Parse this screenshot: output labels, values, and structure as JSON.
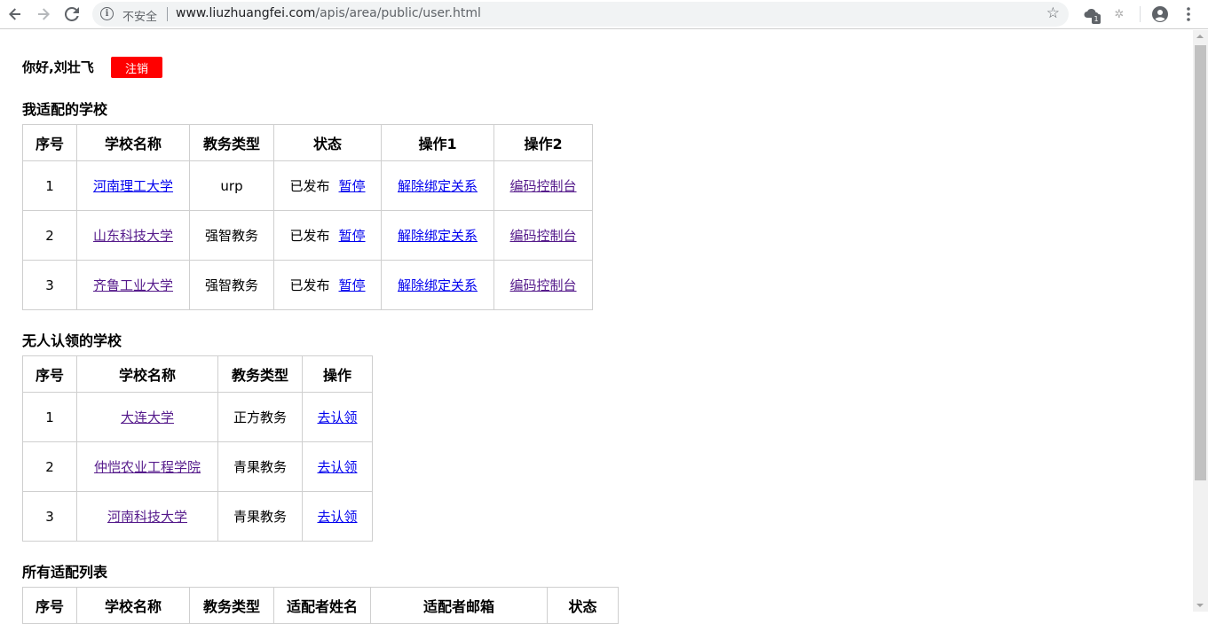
{
  "browser": {
    "insecure_label": "不安全",
    "url_host": "www.liuzhuangfei.com",
    "url_path": "/apis/area/public/user.html",
    "ext_badge": "1"
  },
  "header": {
    "greeting": "你好,刘壮飞",
    "logout_label": "注销",
    "logout_color": "#ff0000"
  },
  "my_schools": {
    "title": "我适配的学校",
    "columns": [
      "序号",
      "学校名称",
      "教务类型",
      "状态",
      "操作1",
      "操作2"
    ],
    "rows": [
      {
        "id": "1",
        "name": "河南理工大学",
        "type": "urp",
        "status": "已发布",
        "toggle": "暂停",
        "op1": "解除绑定关系",
        "op2": "编码控制台"
      },
      {
        "id": "2",
        "name": "山东科技大学",
        "type": "强智教务",
        "status": "已发布",
        "toggle": "暂停",
        "op1": "解除绑定关系",
        "op2": "编码控制台"
      },
      {
        "id": "3",
        "name": "齐鲁工业大学",
        "type": "强智教务",
        "status": "已发布",
        "toggle": "暂停",
        "op1": "解除绑定关系",
        "op2": "编码控制台"
      }
    ]
  },
  "unclaimed": {
    "title": "无人认领的学校",
    "columns": [
      "序号",
      "学校名称",
      "教务类型",
      "操作"
    ],
    "rows": [
      {
        "id": "1",
        "name": "大连大学",
        "type": "正方教务",
        "action": "去认领"
      },
      {
        "id": "2",
        "name": "仲恺农业工程学院",
        "type": "青果教务",
        "action": "去认领"
      },
      {
        "id": "3",
        "name": "河南科技大学",
        "type": "青果教务",
        "action": "去认领"
      }
    ]
  },
  "all_list": {
    "title": "所有适配列表",
    "columns": [
      "序号",
      "学校名称",
      "教务类型",
      "适配者姓名",
      "适配者邮箱",
      "状态"
    ]
  }
}
